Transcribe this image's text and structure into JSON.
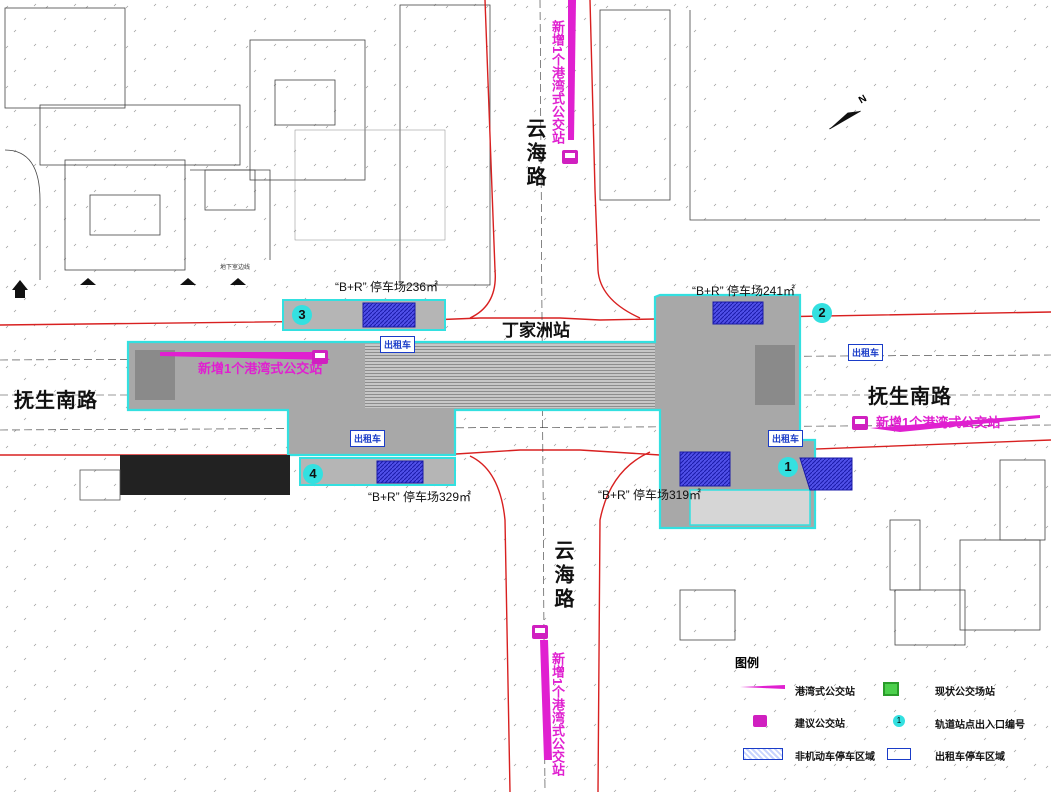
{
  "roads": {
    "ew_left": "抚生南路",
    "ew_right": "抚生南路",
    "ns_top": "云海路",
    "ns_bottom": "云海路"
  },
  "station": {
    "name": "丁家洲站"
  },
  "parking": {
    "p1": "“B+R” 停车场319㎡",
    "p2": "“B+R” 停车场241㎡",
    "p3": "“B+R” 停车场236㎡",
    "p4": "“B+R” 停车场329㎡"
  },
  "entrances": [
    "1",
    "2",
    "3",
    "4"
  ],
  "bus_stops": {
    "top": "新增1个港湾式公交站",
    "left": "新增1个港湾式公交站",
    "right": "新增1个港湾式公交站",
    "bottom": "新增1个港湾式公交站"
  },
  "taxi_label": "出租车",
  "underground_label": "地下室边线",
  "legend": {
    "title": "图例",
    "items": [
      {
        "label": "港湾式公交站",
        "icon": "bay-bus-stop-line"
      },
      {
        "label": "现状公交场站",
        "icon": "existing-bus-icon"
      },
      {
        "label": "建议公交站",
        "icon": "proposed-bus-icon"
      },
      {
        "label": "轨道站点出入口编号",
        "icon": "entrance-number-icon"
      },
      {
        "label": "非机动车停车区域",
        "icon": "bike-parking-hatch"
      },
      {
        "label": "出租车停车区域",
        "icon": "taxi-area-icon"
      }
    ]
  },
  "colors": {
    "station_outline": "#33e0e0",
    "station_fill": "#9e9e9e",
    "parking_hatch": "#3a3ad8",
    "bus_magenta": "#e020d0",
    "road_red": "#d82020",
    "taxi_blue": "#1a3cc8"
  }
}
